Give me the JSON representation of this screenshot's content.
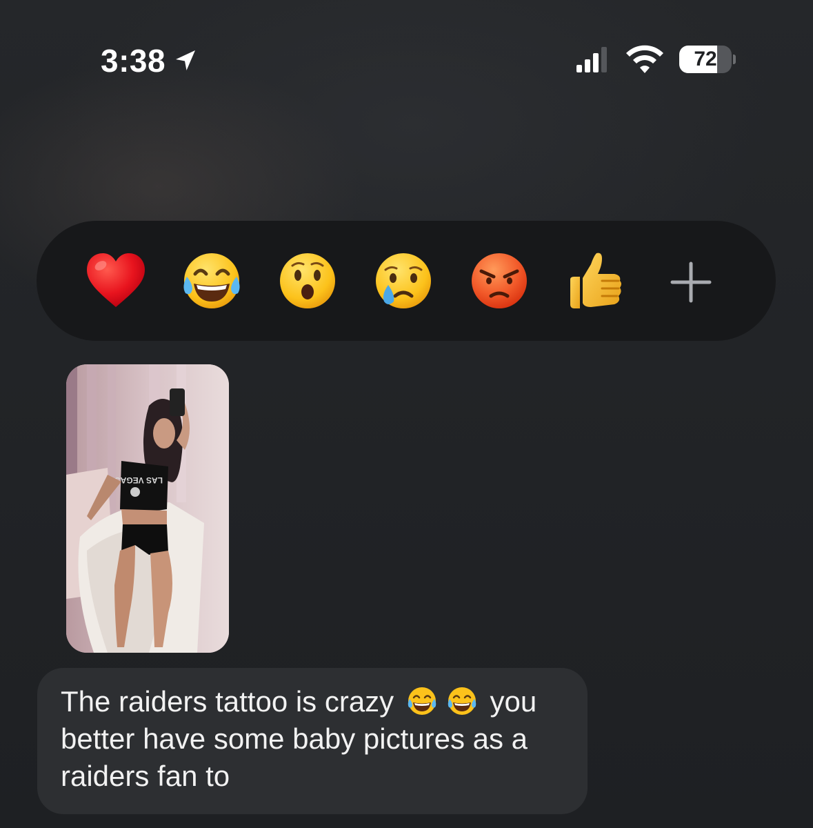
{
  "status_bar": {
    "time": "3:38",
    "battery_text": "72",
    "battery_level_percent": 72,
    "icons": [
      "location-arrow-icon",
      "cellular-signal-icon",
      "wifi-icon",
      "battery-icon"
    ]
  },
  "reaction_bar": {
    "reactions": [
      {
        "name": "red-heart",
        "emoji": "❤️"
      },
      {
        "name": "face-with-tears-of-joy",
        "emoji": "😂"
      },
      {
        "name": "face-with-open-mouth",
        "emoji": "😮"
      },
      {
        "name": "crying-face",
        "emoji": "😢"
      },
      {
        "name": "pouting-face",
        "emoji": "😡"
      },
      {
        "name": "thumbs-up",
        "emoji": "👍"
      }
    ],
    "more_icon": "plus-icon"
  },
  "message": {
    "photo": {
      "shirt_text": "LAS VEGAS"
    },
    "text": {
      "line1_before": "The raiders tattoo is crazy",
      "line1_emoji": "😂😂",
      "line1_after": "you",
      "line2": "better have some baby pictures as a",
      "line3": "raiders fan to"
    }
  },
  "colors": {
    "background": "#1f2124",
    "reaction_bar": "#17181a",
    "bubble": "#2d2f32",
    "text": "#f2f2f2"
  }
}
